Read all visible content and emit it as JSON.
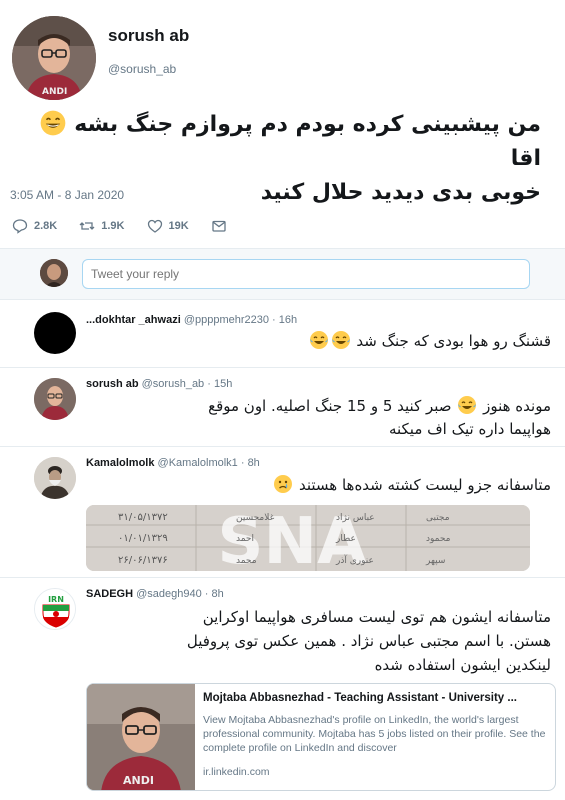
{
  "tweet": {
    "author_name": "sorush ab",
    "author_handle": "@sorush_ab",
    "text_line1": "من پیشبینی کرده بودم دم پروازم جنگ بشه",
    "text_line1_end": "اقا",
    "text_line2": "خوبی بدی دیدید حلال کنید",
    "timestamp": "3:05 AM - 8 Jan 2020",
    "reply_count": "2.8K",
    "retweet_count": "1.9K",
    "like_count": "19K"
  },
  "reply_box": {
    "placeholder": "Tweet your reply"
  },
  "replies": [
    {
      "name": "...dokhtar _ahwazi",
      "handle": "@ppppmehr2230",
      "time": "16h",
      "text": "قشنگ رو هوا بودی که جنگ شد"
    },
    {
      "name": "sorush ab",
      "handle": "@sorush_ab",
      "time": "15h",
      "text_a": "مونده هنوز",
      "text_b": "صبر کنید 5 و 15 جنگ اصلیه. اون موقع",
      "text_c": "هواپیما داره تیک اف میکنه"
    },
    {
      "name": "Kamalolmolk",
      "handle": "@Kamalolmolk1",
      "time": "8h",
      "text": "متاسفانه جزو لیست کشته شده‌ها هستند"
    },
    {
      "name": "SADEGH",
      "handle": "@sadegh940",
      "time": "8h",
      "text_1": "متاسفانه ایشون هم توی لیست مسافری هواپیما اوکراین",
      "text_2": "هستن. با اسم مجتبی عباس نژاد . همین عکس توی پروفیل",
      "text_3": "لینکدین ایشون استفاده شده"
    }
  ],
  "news_image": {
    "watermark": "SNA",
    "rows": [
      {
        "date": "۳۱/۰۵/۱۳۷۲",
        "col2": "غلامحسین",
        "col3": "عباس نژاد",
        "col4": "مجتبی"
      },
      {
        "date": "۰۱/۰۱/۱۳۲۹",
        "col2": "احمد",
        "col3": "عطار",
        "col4": "محمود"
      },
      {
        "date": "۲۶/۰۶/۱۳۷۶",
        "col2": "محمد",
        "col3": "عنوری آذر",
        "col4": "سپهر"
      }
    ]
  },
  "link_card": {
    "title": "Mojtaba Abbasnezhad - Teaching Assistant - University ...",
    "description": "View Mojtaba Abbasnezhad's profile on LinkedIn, the world's largest professional community. Mojtaba has 5 jobs listed on their profile. See the complete profile on LinkedIn and discover",
    "domain": "ir.linkedin.com"
  },
  "colors": {
    "text": "#14171a",
    "secondary": "#657786",
    "border": "#e6ecf0",
    "input_border": "#a7d6f2"
  }
}
